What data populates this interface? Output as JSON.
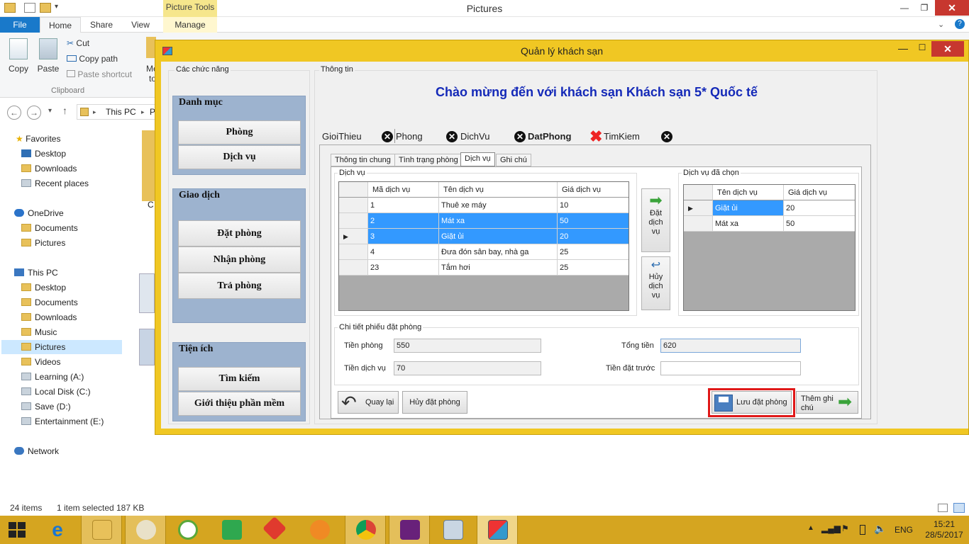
{
  "explorer": {
    "title": "Pictures",
    "context_tab": "Picture Tools",
    "tabs": {
      "file": "File",
      "home": "Home",
      "share": "Share",
      "view": "View",
      "manage": "Manage"
    },
    "ribbon": {
      "copy": "Copy",
      "paste": "Paste",
      "cut": "Cut",
      "copy_path": "Copy path",
      "paste_shortcut": "Paste shortcut",
      "clipboard": "Clipboard",
      "cut_off_me": "Me",
      "cut_off_to": "to"
    },
    "address": {
      "this_pc": "This PC",
      "next": "P"
    },
    "nav": {
      "favorites": "Favorites",
      "desktop": "Desktop",
      "downloads": "Downloads",
      "recent": "Recent places",
      "onedrive": "OneDrive",
      "od_documents": "Documents",
      "od_pictures": "Pictures",
      "this_pc": "This PC",
      "pc_desktop": "Desktop",
      "pc_documents": "Documents",
      "pc_downloads": "Downloads",
      "pc_music": "Music",
      "pc_pictures": "Pictures",
      "pc_videos": "Videos",
      "learning": "Learning (A:)",
      "local_disk": "Local Disk (C:)",
      "save": "Save (D:)",
      "entertainment": "Entertainment (E:)",
      "network": "Network"
    },
    "content_fragment": "C",
    "status": {
      "items": "24 items",
      "selected": "1 item selected",
      "size": "187 KB"
    }
  },
  "app": {
    "title": "Quản lý khách sạn",
    "functions_caption": "Các chức năng",
    "danh_muc": {
      "header": "Danh mục",
      "phong": "Phòng",
      "dich_vu": "Dịch vụ"
    },
    "giao_dich": {
      "header": "Giao dịch",
      "dat_phong": "Đặt phòng",
      "nhan_phong": "Nhận phòng",
      "tra_phong": "Trả phòng"
    },
    "tien_ich": {
      "header": "Tiện ích",
      "tim_kiem": "Tìm kiếm",
      "gioi_thieu": "Giới thiệu phần mềm"
    },
    "info_caption": "Thông tin",
    "welcome": "Chào mừng đến với khách sạn Khách sạn 5* Quốc tế",
    "main_tabs": [
      "GioiThieu",
      "Phong",
      "DichVu",
      "DatPhong",
      "TimKiem"
    ],
    "sub_tabs": [
      "Thông tin chung",
      "Tình trạng phòng",
      "Dịch vụ",
      "Ghi chú"
    ],
    "services": {
      "caption": "Dịch vụ",
      "headers": [
        "Mã dịch vụ",
        "Tên dịch vụ",
        "Giá dịch vụ"
      ],
      "rows": [
        [
          "1",
          "Thuê xe máy",
          "10"
        ],
        [
          "2",
          "Mát xa",
          "50"
        ],
        [
          "3",
          "Giặt ủi",
          "20"
        ],
        [
          "4",
          "Đưa đón sân bay, nhà ga",
          "25"
        ],
        [
          "23",
          "Tắm hơi",
          "25"
        ]
      ]
    },
    "add_service": [
      "Đặt",
      "dịch",
      "vụ"
    ],
    "cancel_service": [
      "Hủy",
      "dịch",
      "vụ"
    ],
    "chosen": {
      "caption": "Dịch vụ đã chọn",
      "headers": [
        "Tên dịch vụ",
        "Giá dịch vụ"
      ],
      "rows": [
        [
          "Giặt ủi",
          "20"
        ],
        [
          "Mát xa",
          "50"
        ]
      ]
    },
    "detail": {
      "caption": "Chi tiết phiếu đặt phòng",
      "tien_phong_lbl": "Tiền phòng",
      "tien_phong": "550",
      "tien_dich_vu_lbl": "Tiền dịch vụ",
      "tien_dich_vu": "70",
      "tong_tien_lbl": "Tổng tiền",
      "tong_tien": "620",
      "tien_dat_truoc_lbl": "Tiền đặt trước",
      "tien_dat_truoc": ""
    },
    "buttons": {
      "back": "Quay lại",
      "cancel_booking": "Hủy đặt phòng",
      "save_booking": "Lưu đặt phòng",
      "add_note": [
        "Thêm ghi",
        "chú"
      ]
    }
  },
  "taskbar": {
    "lang": "ENG",
    "time": "15:21",
    "date": "28/5/2017"
  },
  "colors": {
    "app_frame": "#f0c723",
    "welcome_text": "#1429b8",
    "selection": "#3399ff",
    "menu_panel": "#9db3cf",
    "highlight_border": "#e01818",
    "taskbar": "#d5a520"
  }
}
